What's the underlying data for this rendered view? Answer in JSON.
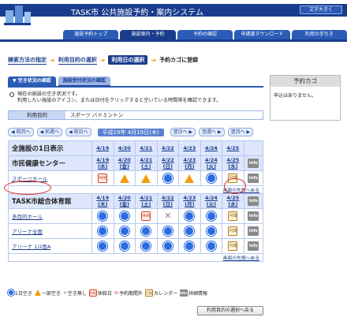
{
  "header": {
    "title": "TASK市 公共施設予約・案内システム",
    "font_button": "文字大きく"
  },
  "nav": [
    "施設予約トップ",
    "施設案内・予約",
    "予約の確認",
    "申請書ダウンロード",
    "利用の手引き"
  ],
  "breadcrumb": {
    "s1": "検索方法の指定",
    "s2": "利用目的の選択",
    "s3": "利用日の選択",
    "s4": "予約カゴに登録"
  },
  "tabs": {
    "t1": "▼ 空き状況の確認",
    "t2": "施設受付状況の確認"
  },
  "info": {
    "line1": "現在の施設の空き状況です。",
    "line2": "利用したい施設のアイコン、または日付をクリックすると空いている時間帯を確認できます。"
  },
  "purpose": {
    "label": "利用目的",
    "value": "スポーツ バドミントン"
  },
  "datenav": {
    "prev_month": "◀ 前月へ",
    "prev_week": "◀ 前週へ",
    "prev_day": "◀ 前日へ",
    "current": "平成19年 4月19日(木)",
    "next_day": "翌日へ ▶",
    "next_week": "翌週へ ▶",
    "next_month": "翌月へ ▶"
  },
  "grid": {
    "all_label": "全施設の1日表示",
    "dates": [
      "4/19",
      "4/20",
      "4/21",
      "4/22",
      "4/23",
      "4/24",
      "4/25"
    ],
    "days": [
      "(木)",
      "(金)",
      "(土)",
      "(日)",
      "(月)",
      "(火)",
      "(水)"
    ],
    "group1": {
      "name": "市民健康センター",
      "rows": [
        {
          "name": "スポーツホール",
          "cells": [
            "ky",
            "tri",
            "tri",
            "circle",
            "tri",
            "circle",
            "mon"
          ]
        }
      ]
    },
    "group2": {
      "name": "TASK市総合体育館",
      "rows": [
        {
          "name": "多目的ホール",
          "cells": [
            "circle",
            "circle",
            "ky",
            "xx",
            "circle",
            "circle",
            "mon"
          ]
        },
        {
          "name": "アリーナ全面",
          "cells": [
            "circle",
            "circle",
            "circle",
            "circle",
            "circle",
            "circle",
            "mon"
          ]
        },
        {
          "name": "アリーナ 1/2面A",
          "cells": [
            "circle",
            "circle",
            "circle",
            "circle",
            "circle",
            "circle",
            "mon"
          ]
        }
      ]
    },
    "top_link": "画面の先頭へ戻る",
    "info_label": "Info",
    "kyu_label": "休館",
    "mon_label": "月間"
  },
  "legend": {
    "l1": "1日空き",
    "l2": "一部空き",
    "l3": "空き無し",
    "l4": "休館日",
    "l5": "予約期間外",
    "l6": "カレンダー",
    "l7": "詳細情報"
  },
  "back_button": "利用目的の選択へ戻る",
  "cart": {
    "title": "予約カゴ",
    "empty": "申込はありません。"
  }
}
